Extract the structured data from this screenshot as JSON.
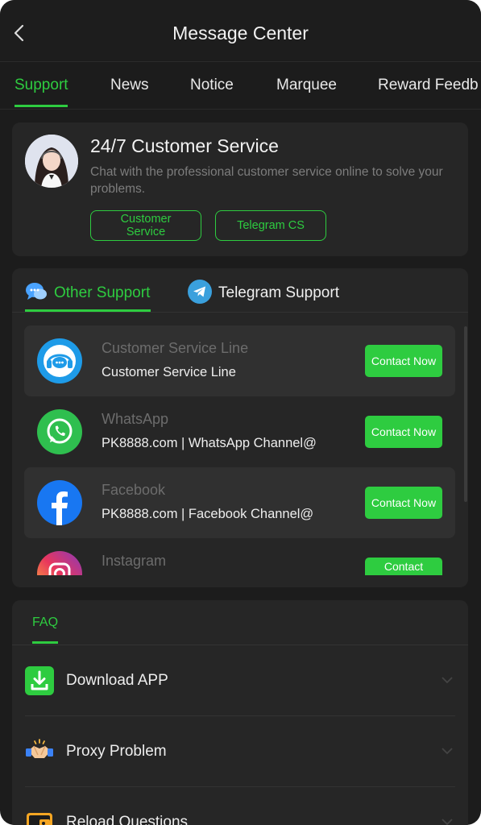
{
  "header": {
    "title": "Message Center"
  },
  "tabs": [
    {
      "label": "Support"
    },
    {
      "label": "News"
    },
    {
      "label": "Notice"
    },
    {
      "label": "Marquee"
    },
    {
      "label": "Reward Feedb"
    }
  ],
  "customer_service": {
    "title": "24/7 Customer Service",
    "description": "Chat with the professional customer service online to solve your problems.",
    "buttons": {
      "customer_service": "Customer Service",
      "telegram_cs": "Telegram CS"
    }
  },
  "support": {
    "tabs": [
      {
        "label": "Other Support"
      },
      {
        "label": "Telegram Support"
      }
    ],
    "items": [
      {
        "name": "Customer Service Line",
        "detail": "Customer Service Line",
        "button": "Contact Now",
        "icon": "headset-icon"
      },
      {
        "name": "WhatsApp",
        "detail": "PK8888.com | WhatsApp Channel@",
        "button": "Contact Now",
        "icon": "whatsapp-icon"
      },
      {
        "name": "Facebook",
        "detail": "PK8888.com | Facebook Channel@",
        "button": "Contact Now",
        "icon": "facebook-icon"
      },
      {
        "name": "Instagram",
        "detail": "",
        "button": "Contact",
        "icon": "instagram-icon"
      }
    ]
  },
  "faq": {
    "tab": "FAQ",
    "items": [
      {
        "label": "Download APP",
        "icon": "download-icon"
      },
      {
        "label": "Proxy Problem",
        "icon": "handshake-icon"
      },
      {
        "label": "Reload Questions",
        "icon": "wallet-icon"
      }
    ]
  },
  "colors": {
    "accent": "#2ecc40",
    "background": "#1c1c1c",
    "card": "#262626"
  }
}
